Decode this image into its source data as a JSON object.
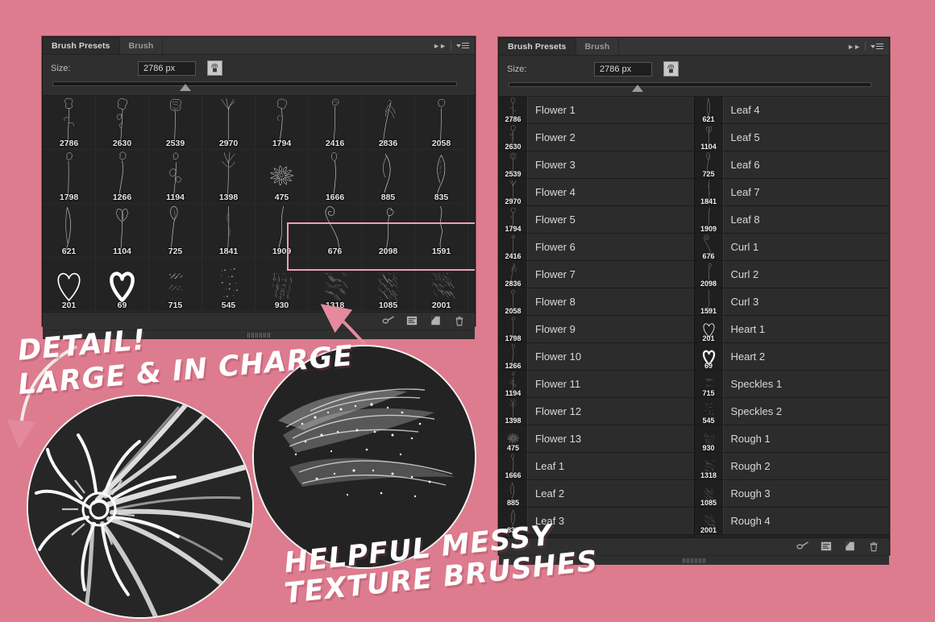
{
  "background_color": "#dd7c8e",
  "left_panel": {
    "tabs": [
      {
        "label": "Brush Presets",
        "active": true
      },
      {
        "label": "Brush",
        "active": false
      }
    ],
    "size_label": "Size:",
    "size_value": "2786 px",
    "brush_icon": "new-brush-preset-icon",
    "grid_rows": [
      [
        {
          "num": "2786",
          "kind": "flower-a"
        },
        {
          "num": "2630",
          "kind": "flower-b"
        },
        {
          "num": "2539",
          "kind": "flower-c"
        },
        {
          "num": "2970",
          "kind": "flower-d"
        },
        {
          "num": "1794",
          "kind": "flower-e"
        },
        {
          "num": "2416",
          "kind": "flower-f"
        },
        {
          "num": "2836",
          "kind": "flower-g"
        },
        {
          "num": "2058",
          "kind": "flower-h"
        }
      ],
      [
        {
          "num": "1798",
          "kind": "flower-i"
        },
        {
          "num": "1266",
          "kind": "flower-j"
        },
        {
          "num": "1194",
          "kind": "flower-k"
        },
        {
          "num": "1398",
          "kind": "flower-l"
        },
        {
          "num": "475",
          "kind": "daisy"
        },
        {
          "num": "1666",
          "kind": "leaf-a"
        },
        {
          "num": "885",
          "kind": "leaf-b"
        },
        {
          "num": "835",
          "kind": "leaf-c"
        }
      ],
      [
        {
          "num": "621",
          "kind": "leaf-d"
        },
        {
          "num": "1104",
          "kind": "leaf-e"
        },
        {
          "num": "725",
          "kind": "leaf-f"
        },
        {
          "num": "1841",
          "kind": "leaf-g"
        },
        {
          "num": "1909",
          "kind": "leaf-h"
        },
        {
          "num": "676",
          "kind": "curl-a"
        },
        {
          "num": "2098",
          "kind": "curl-b"
        },
        {
          "num": "1591",
          "kind": "curl-c"
        }
      ],
      [
        {
          "num": "201",
          "kind": "heart-outline"
        },
        {
          "num": "69",
          "kind": "heart-solid"
        },
        {
          "num": "715",
          "kind": "speckles-a"
        },
        {
          "num": "545",
          "kind": "speckles-b"
        },
        {
          "num": "930",
          "kind": "rough-a"
        },
        {
          "num": "1318",
          "kind": "rough-b"
        },
        {
          "num": "1085",
          "kind": "rough-c"
        },
        {
          "num": "2001",
          "kind": "rough-d"
        }
      ]
    ],
    "highlight_color": "#f0a0b2",
    "toolbar_icons": [
      "brush-stroke-icon",
      "preset-manager-icon",
      "new-brush-icon",
      "trash-icon"
    ]
  },
  "right_panel": {
    "tabs": [
      {
        "label": "Brush Presets",
        "active": true
      },
      {
        "label": "Brush",
        "active": false
      }
    ],
    "size_label": "Size:",
    "size_value": "2786 px",
    "brush_icon": "new-brush-preset-icon",
    "list_left": [
      {
        "num": "2786",
        "name": "Flower 1",
        "kind": "flower-a"
      },
      {
        "num": "2630",
        "name": "Flower 2",
        "kind": "flower-b"
      },
      {
        "num": "2539",
        "name": "Flower 3",
        "kind": "flower-c"
      },
      {
        "num": "2970",
        "name": "Flower 4",
        "kind": "flower-d"
      },
      {
        "num": "1794",
        "name": "Flower 5",
        "kind": "flower-e"
      },
      {
        "num": "2416",
        "name": "Flower 6",
        "kind": "flower-f"
      },
      {
        "num": "2836",
        "name": "Flower 7",
        "kind": "flower-g"
      },
      {
        "num": "2058",
        "name": "Flower 8",
        "kind": "flower-h"
      },
      {
        "num": "1798",
        "name": "Flower 9",
        "kind": "flower-i"
      },
      {
        "num": "1266",
        "name": "Flower 10",
        "kind": "flower-j"
      },
      {
        "num": "1194",
        "name": "Flower 11",
        "kind": "flower-k"
      },
      {
        "num": "1398",
        "name": "Flower 12",
        "kind": "flower-l"
      },
      {
        "num": "475",
        "name": "Flower 13",
        "kind": "daisy"
      },
      {
        "num": "1666",
        "name": "Leaf 1",
        "kind": "leaf-a"
      },
      {
        "num": "885",
        "name": "Leaf 2",
        "kind": "leaf-b"
      },
      {
        "num": "835",
        "name": "Leaf 3",
        "kind": "leaf-c"
      }
    ],
    "list_right": [
      {
        "num": "621",
        "name": "Leaf 4",
        "kind": "leaf-d"
      },
      {
        "num": "1104",
        "name": "Leaf 5",
        "kind": "leaf-e"
      },
      {
        "num": "725",
        "name": "Leaf 6",
        "kind": "leaf-f"
      },
      {
        "num": "1841",
        "name": "Leaf 7",
        "kind": "leaf-g"
      },
      {
        "num": "1909",
        "name": "Leaf 8",
        "kind": "leaf-h"
      },
      {
        "num": "676",
        "name": "Curl 1",
        "kind": "curl-a"
      },
      {
        "num": "2098",
        "name": "Curl 2",
        "kind": "curl-b"
      },
      {
        "num": "1591",
        "name": "Curl 3",
        "kind": "curl-c"
      },
      {
        "num": "201",
        "name": "Heart 1",
        "kind": "heart-outline"
      },
      {
        "num": "69",
        "name": "Heart 2",
        "kind": "heart-solid"
      },
      {
        "num": "715",
        "name": "Speckles 1",
        "kind": "speckles-a"
      },
      {
        "num": "545",
        "name": "Speckles 2",
        "kind": "speckles-b"
      },
      {
        "num": "930",
        "name": "Rough 1",
        "kind": "rough-a"
      },
      {
        "num": "1318",
        "name": "Rough 2",
        "kind": "rough-b"
      },
      {
        "num": "1085",
        "name": "Rough 3",
        "kind": "rough-c"
      },
      {
        "num": "2001",
        "name": "Rough 4",
        "kind": "rough-d"
      }
    ],
    "toolbar_icons": [
      "brush-stroke-icon",
      "preset-manager-icon",
      "new-brush-icon",
      "trash-icon"
    ]
  },
  "annotations": {
    "headline_1_line_1": "DETAIL!",
    "headline_1_line_2": "LARGE & IN CHARGE",
    "headline_2_line_1": "HELPFUL MESSY",
    "headline_2_line_2": "TEXTURE BRUSHES",
    "text_color": "#ffffff",
    "arrow_color": "#e58a9e"
  }
}
